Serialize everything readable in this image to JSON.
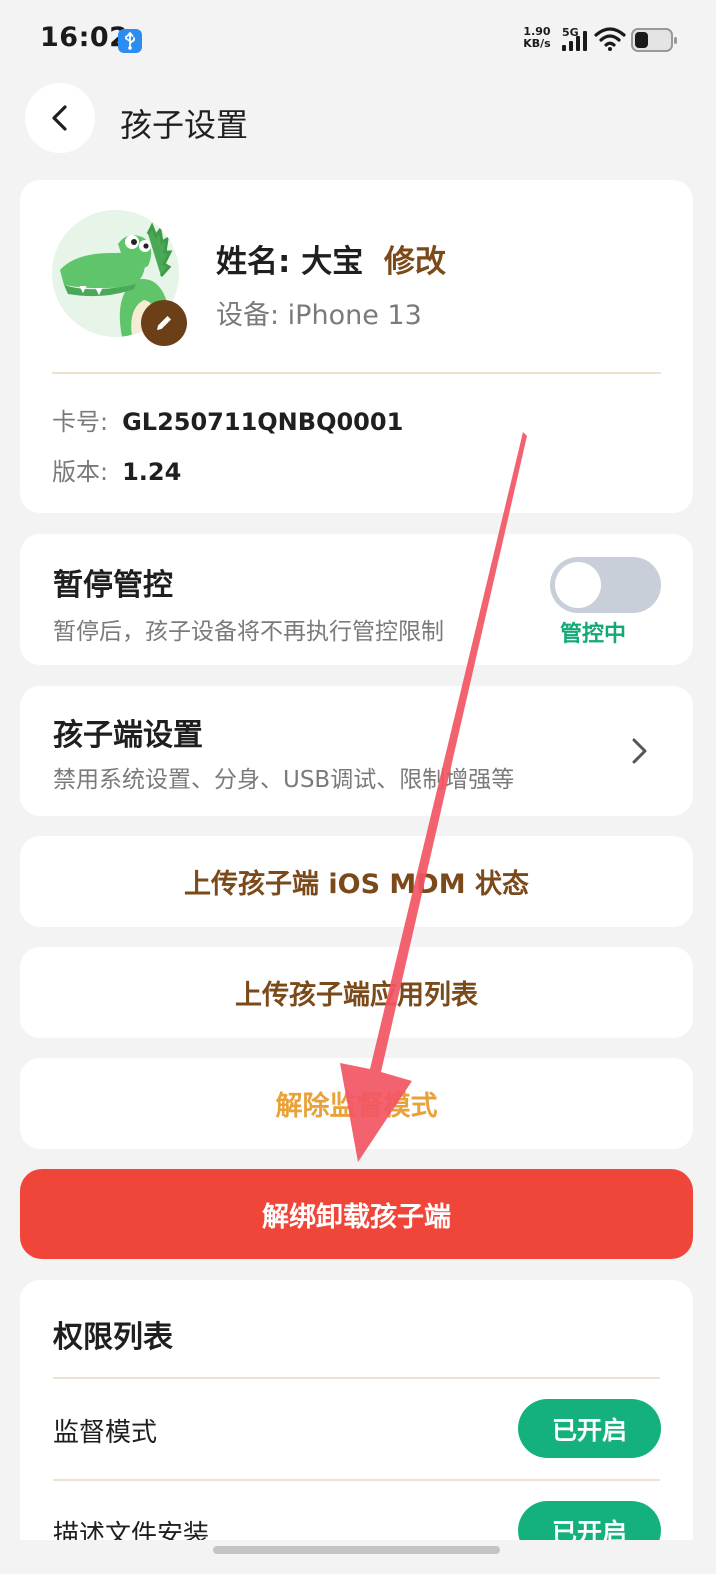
{
  "status_bar": {
    "time": "16:02",
    "net_speed_value": "1.90",
    "net_speed_unit": "KB/s",
    "network_type": "5G",
    "icons": [
      "usb-icon",
      "signal-icon",
      "wifi-icon",
      "battery-icon"
    ]
  },
  "header": {
    "title": "孩子设置"
  },
  "profile": {
    "name_label": "姓名: 大宝",
    "modify_label": "修改",
    "device_label": "设备: iPhone 13",
    "card_label": "卡号:",
    "card_value": "GL250711QNBQ0001",
    "version_label": "版本:",
    "version_value": "1.24"
  },
  "pause_control": {
    "title": "暂停管控",
    "description": "暂停后，孩子设备将不再执行管控限制",
    "toggle_status": "管控中",
    "toggle_on": false
  },
  "child_settings": {
    "title": "孩子端设置",
    "description": "禁用系统设置、分身、USB调试、限制增强等"
  },
  "actions": {
    "upload_mdm": "上传孩子端 iOS MDM 状态",
    "upload_apps": "上传孩子端应用列表",
    "remove_supervision": "解除监督模式",
    "unbind_uninstall": "解绑卸载孩子端"
  },
  "permissions": {
    "title": "权限列表",
    "items": [
      {
        "label": "监督模式",
        "status": "已开启"
      },
      {
        "label": "描述文件安装",
        "status": "已开启"
      }
    ]
  },
  "colors": {
    "accent_brown": "#7b4a1a",
    "warning_orange": "#e9a23a",
    "danger_red": "#f0463a",
    "success_green": "#14b17e",
    "annotation_arrow": "#f25563"
  }
}
